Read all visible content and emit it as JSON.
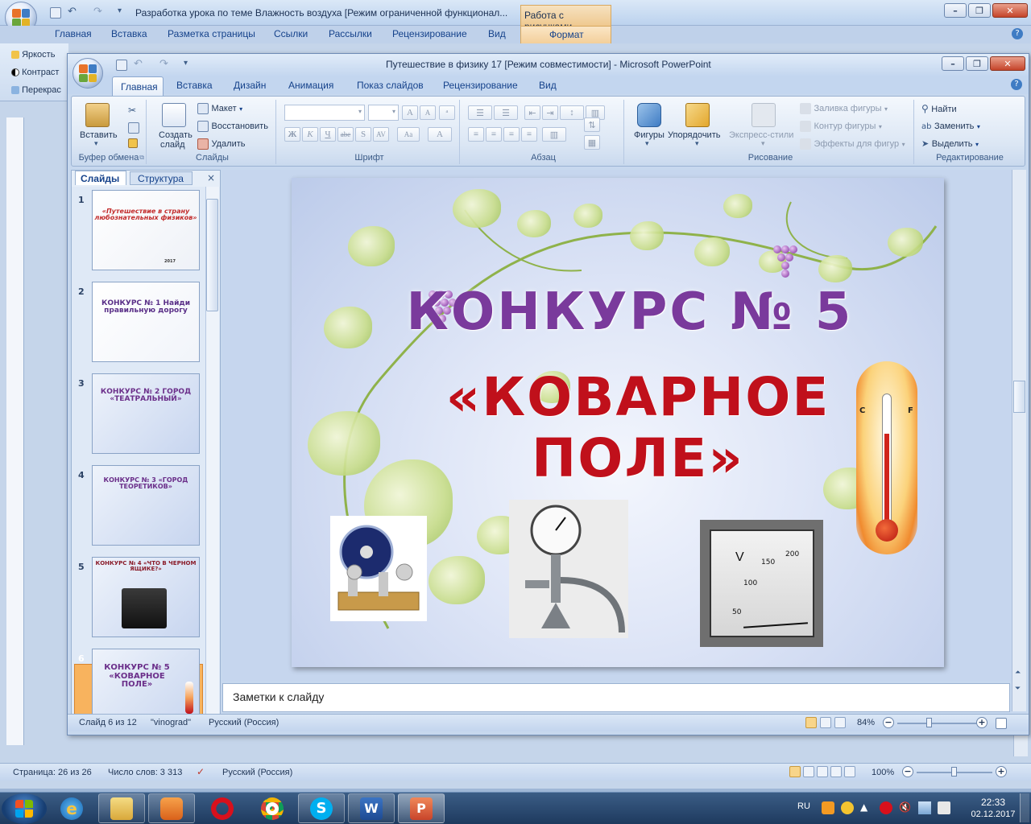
{
  "word": {
    "title": "Разработка урока по теме Влажность воздуха [Режим ограниченной функционал...",
    "context_tab": "Работа с рисунками",
    "tabs": [
      "Главная",
      "Вставка",
      "Разметка страницы",
      "Ссылки",
      "Рассылки",
      "Рецензирование",
      "Вид",
      "Формат"
    ],
    "left_ribbon": [
      "Яркость",
      "Контраст",
      "Перекрас"
    ],
    "status": {
      "page": "Страница: 26 из 26",
      "words": "Число слов: 3 313",
      "lang": "Русский (Россия)",
      "zoom": "100%"
    }
  },
  "ppt": {
    "title": "Путешествие  в физику 17 [Режим совместимости] - Microsoft PowerPoint",
    "tabs": [
      "Главная",
      "Вставка",
      "Дизайн",
      "Анимация",
      "Показ слайдов",
      "Рецензирование",
      "Вид"
    ],
    "ribbon": {
      "clipboard": {
        "label": "Буфер обмена",
        "paste": "Вставить"
      },
      "slides": {
        "label": "Слайды",
        "new_slide_1": "Создать",
        "new_slide_2": "слайд",
        "layout": "Макет",
        "reset": "Восстановить",
        "delete": "Удалить"
      },
      "font": {
        "label": "Шрифт"
      },
      "paragraph": {
        "label": "Абзац"
      },
      "drawing": {
        "label": "Рисование",
        "shapes": "Фигуры",
        "arrange": "Упорядочить",
        "quick_styles": "Экспресс-стили",
        "fill": "Заливка фигуры",
        "outline": "Контур фигуры",
        "effects": "Эффекты для фигур"
      },
      "editing": {
        "label": "Редактирование",
        "find": "Найти",
        "replace": "Заменить",
        "select": "Выделить"
      }
    },
    "pane": {
      "tab_slides": "Слайды",
      "tab_outline": "Структура",
      "close": "×"
    },
    "thumbs": [
      {
        "num": "1",
        "text": "«Путешествие в страну любознательных физиков»",
        "sub": "2017"
      },
      {
        "num": "2",
        "text": "КОНКУРС № 1 Найди правильную дорогу",
        "sub": ""
      },
      {
        "num": "3",
        "text": "КОНКУРС № 2 ГОРОД «ТЕАТРАЛЬНЫЙ»",
        "sub": ""
      },
      {
        "num": "4",
        "text": "КОНКУРС № 3 «ГОРОД ТЕОРЕТИКОВ»",
        "sub": ""
      },
      {
        "num": "5",
        "text": "КОНКУРС № 4 «ЧТО В ЧЕРНОМ ЯЩИКЕ?»",
        "sub": ""
      },
      {
        "num": "6",
        "text": "КОНКУРС № 5 «КОВАРНОЕ ПОЛЕ»",
        "sub": ""
      }
    ],
    "slide": {
      "title": "КОНКУРС № 5",
      "subtitle_1": "«КОВАРНОЕ",
      "subtitle_2": "ПОЛЕ»",
      "voltmeter_unit": "V",
      "voltmeter_marks": [
        "50",
        "100",
        "150",
        "200"
      ],
      "thermo_c": "C",
      "thermo_f": "F"
    },
    "notes": "Заметки к слайду",
    "status": {
      "slide": "Слайд 6 из 12",
      "theme": "\"vinograd\"",
      "lang": "Русский (Россия)",
      "zoom": "84%"
    }
  },
  "taskbar": {
    "lang": "RU",
    "time": "22:33",
    "date": "02.12.2017"
  },
  "colors": {
    "accent": "#15428b",
    "title_purple": "#7a3a9c",
    "title_red": "#c0101b",
    "selected_thumb": "#f8b35e"
  }
}
